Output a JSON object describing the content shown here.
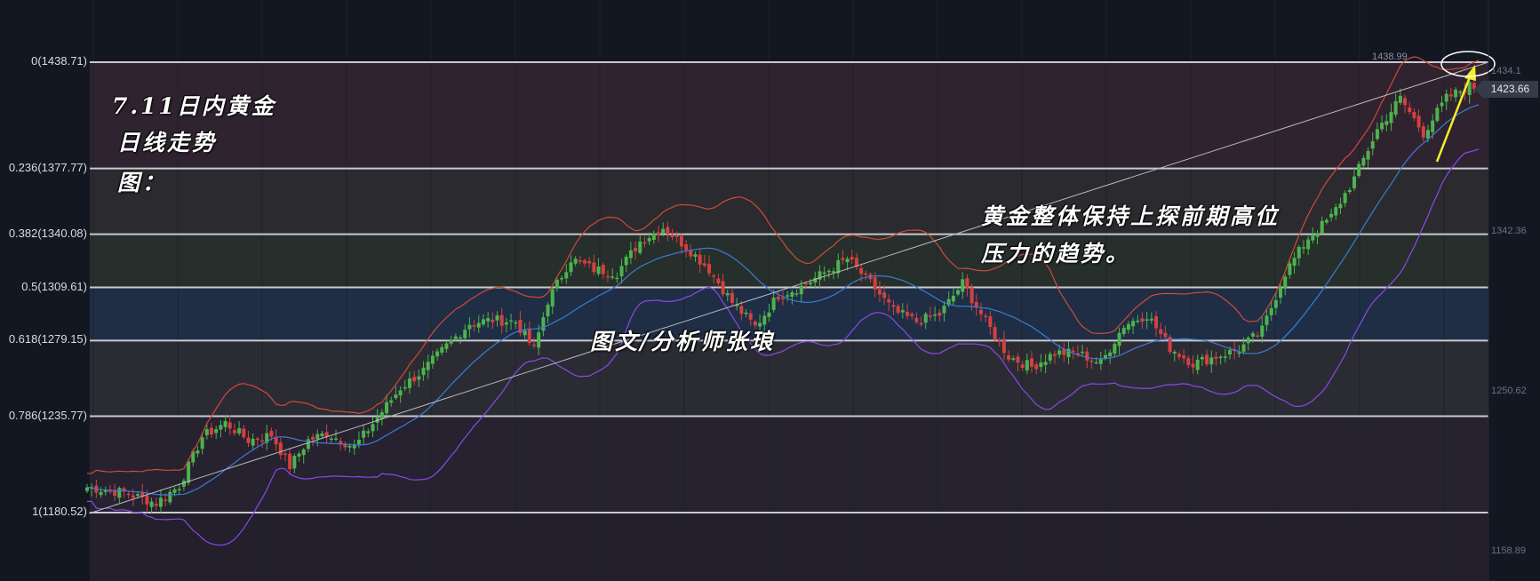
{
  "chart_data": {
    "type": "candlestick",
    "instrument_note": "7.11日内黄金",
    "fib_levels": [
      {
        "ratio": "0",
        "price": 1438.71,
        "label": "0(1438.71)"
      },
      {
        "ratio": "0.236",
        "price": 1377.77,
        "label": "0.236(1377.77)"
      },
      {
        "ratio": "0.382",
        "price": 1340.08,
        "label": "0.382(1340.08)"
      },
      {
        "ratio": "0.5",
        "price": 1309.61,
        "label": "0.5(1309.61)"
      },
      {
        "ratio": "0.618",
        "price": 1279.15,
        "label": "0.618(1279.15)"
      },
      {
        "ratio": "0.786",
        "price": 1235.77,
        "label": "0.786(1235.77)"
      },
      {
        "ratio": "1",
        "price": 1180.52,
        "label": "1(1180.52)"
      }
    ],
    "y_axis_ticks": [
      "1434.1",
      "1342.36",
      "1250.62",
      "1158.89"
    ],
    "last_price": "1423.66",
    "high_label": "1438.99",
    "ylim": [
      1142,
      1460
    ],
    "anchors": [
      [
        0,
        1195
      ],
      [
        8,
        1192
      ],
      [
        15,
        1186
      ],
      [
        20,
        1196
      ],
      [
        25,
        1224
      ],
      [
        30,
        1232
      ],
      [
        35,
        1222
      ],
      [
        40,
        1225
      ],
      [
        44,
        1207
      ],
      [
        48,
        1222
      ],
      [
        52,
        1226
      ],
      [
        58,
        1218
      ],
      [
        63,
        1235
      ],
      [
        68,
        1252
      ],
      [
        73,
        1262
      ],
      [
        78,
        1276
      ],
      [
        83,
        1289
      ],
      [
        88,
        1291
      ],
      [
        93,
        1290
      ],
      [
        97,
        1274
      ],
      [
        100,
        1302
      ],
      [
        105,
        1326
      ],
      [
        110,
        1320
      ],
      [
        115,
        1318
      ],
      [
        120,
        1336
      ],
      [
        125,
        1344
      ],
      [
        130,
        1333
      ],
      [
        135,
        1320
      ],
      [
        140,
        1301
      ],
      [
        145,
        1287
      ],
      [
        150,
        1305
      ],
      [
        155,
        1310
      ],
      [
        160,
        1318
      ],
      [
        165,
        1326
      ],
      [
        170,
        1312
      ],
      [
        175,
        1296
      ],
      [
        180,
        1290
      ],
      [
        185,
        1294
      ],
      [
        190,
        1312
      ],
      [
        195,
        1290
      ],
      [
        200,
        1270
      ],
      [
        205,
        1264
      ],
      [
        210,
        1272
      ],
      [
        215,
        1272
      ],
      [
        220,
        1266
      ],
      [
        225,
        1288
      ],
      [
        230,
        1294
      ],
      [
        235,
        1275
      ],
      [
        240,
        1266
      ],
      [
        245,
        1270
      ],
      [
        250,
        1274
      ],
      [
        255,
        1285
      ],
      [
        260,
        1318
      ],
      [
        265,
        1338
      ],
      [
        270,
        1350
      ],
      [
        275,
        1372
      ],
      [
        280,
        1400
      ],
      [
        285,
        1418
      ],
      [
        290,
        1398
      ],
      [
        295,
        1418
      ],
      [
        300,
        1425
      ],
      [
        302,
        1423.66
      ]
    ],
    "notes": {
      "left_line1": "7.11日内黄金",
      "left_line2": "日线走势",
      "left_line3": "图：",
      "middle": "图文/分析师张琅",
      "right_line1": "黄金整体保持上探前期高位",
      "right_line2": "压力的趋势。"
    },
    "colors": {
      "up": "#4db34d",
      "down": "#d44040",
      "bb_upper": "#d04a3a",
      "bb_lower": "#8a48e8",
      "ma": "#3d7bd9",
      "trend": "#b9b9bd",
      "arrow": "#f2ee2a",
      "fib": "#c9c9cf"
    }
  }
}
